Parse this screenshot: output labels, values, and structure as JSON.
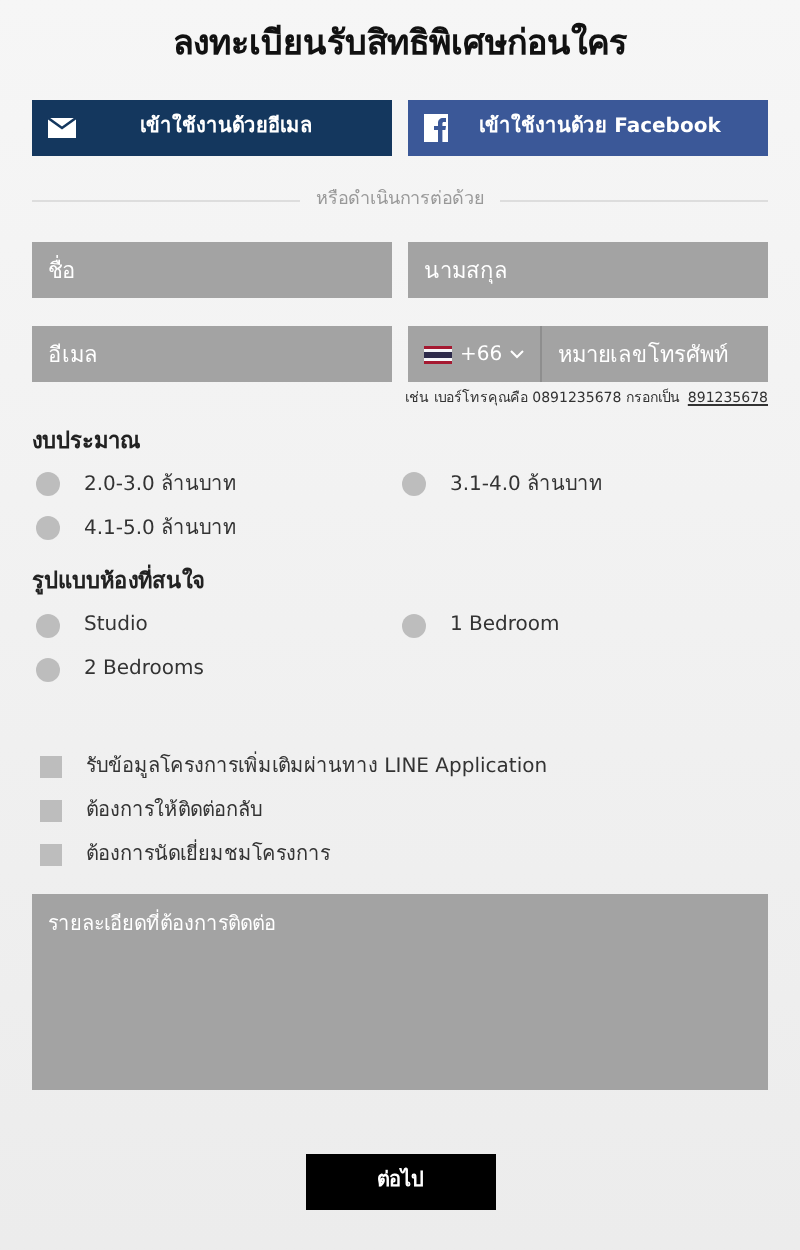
{
  "title": "ลงทะเบียนรับสิทธิพิเศษก่อนใคร",
  "login_buttons": [
    {
      "kind": "email",
      "label": "เข้าใช้งานด้วยอีเมล"
    },
    {
      "kind": "facebook",
      "label": "เข้าใช้งานด้วย Facebook"
    }
  ],
  "divider_text": "หรือดำเนินการต่อด้วย",
  "fields": {
    "first_name": {
      "placeholder": "ชื่อ"
    },
    "last_name": {
      "placeholder": "นามสกุล"
    },
    "email": {
      "placeholder": "อีเมล"
    },
    "phone": {
      "country_code": "+66",
      "placeholder": "หมายเลขโทรศัพท์"
    }
  },
  "phone_hint": {
    "text": "เช่น เบอร์โทรคุณคือ 0891235678 กรอกเป็น",
    "link": "891235678"
  },
  "budget": {
    "label": "งบประมาณ",
    "options": [
      {
        "label": "2.0-3.0 ล้านบาท",
        "selected": false
      },
      {
        "label": "3.1-4.0 ล้านบาท",
        "selected": false
      },
      {
        "label": "4.1-5.0 ล้านบาท",
        "selected": false
      }
    ]
  },
  "room_type": {
    "label": "รูปแบบห้องที่สนใจ",
    "options": [
      {
        "label": "Studio",
        "selected": false
      },
      {
        "label": "1 Bedroom",
        "selected": false
      },
      {
        "label": "2 Bedrooms",
        "selected": false
      }
    ]
  },
  "checkboxes": [
    {
      "label": "รับข้อมูลโครงการเพิ่มเติมผ่านทาง LINE Application",
      "checked": false
    },
    {
      "label": "ต้องการให้ติดต่อกลับ",
      "checked": false
    },
    {
      "label": "ต้องการนัดเยี่ยมชมโครงการ",
      "checked": false
    }
  ],
  "details": {
    "placeholder": "รายละเอียดที่ต้องการติดต่อ"
  },
  "submit": "ต่อไป"
}
